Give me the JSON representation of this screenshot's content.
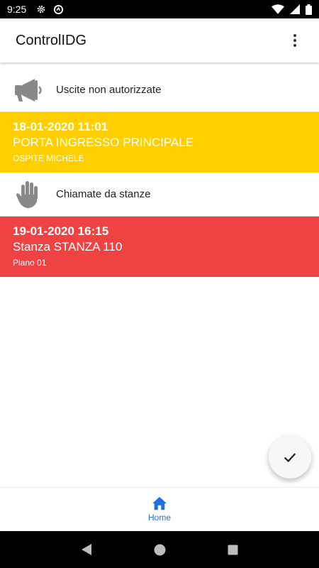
{
  "status_bar": {
    "time": "9:25",
    "icons": [
      "gear-icon",
      "sync-icon",
      "wifi-icon",
      "signal-icon",
      "battery-icon"
    ]
  },
  "app_bar": {
    "title": "ControlIDG",
    "menu_icon": "more-vert-icon"
  },
  "sections": [
    {
      "icon": "megaphone-icon",
      "label": "Uscite non autorizzate"
    },
    {
      "icon": "hand-icon",
      "label": "Chiamate da stanze"
    }
  ],
  "alerts": [
    {
      "color": "#ffcf00",
      "datetime": "18-01-2020 11:01",
      "title": "PORTA INGRESSO PRINCIPALE",
      "subtitle": "OSPITE MICHELE"
    },
    {
      "color": "#ee4243",
      "datetime": "19-01-2020 16:15",
      "title": "Stanza STANZA 110",
      "subtitle": "Piano 01"
    }
  ],
  "fab": {
    "icon": "check-icon"
  },
  "bottom_nav": {
    "home_label": "Home",
    "home_icon": "home-icon",
    "accent": "#1e6fe0"
  },
  "system_nav": [
    "back-icon",
    "home-circle-icon",
    "recents-icon"
  ]
}
